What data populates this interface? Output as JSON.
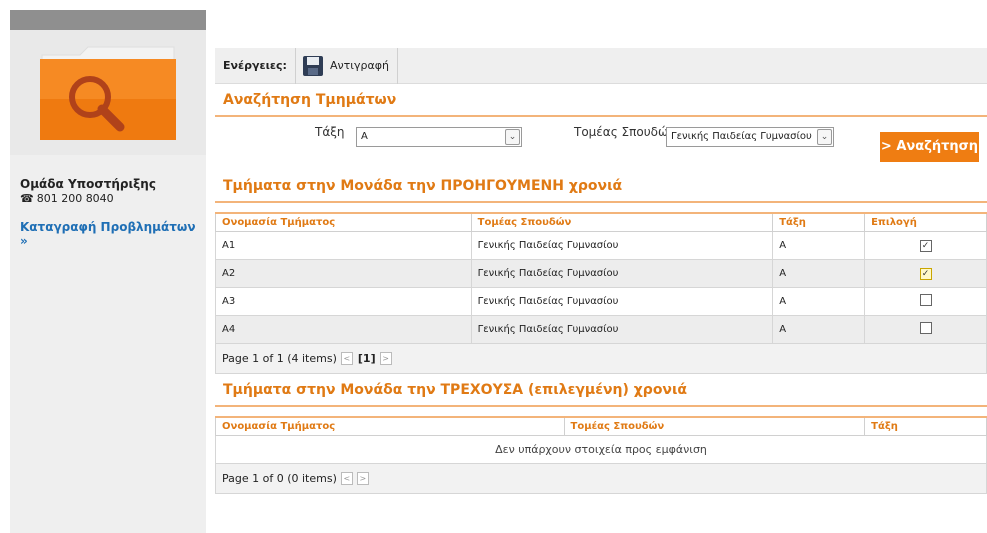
{
  "sidebar": {
    "support_title": "Ομάδα Υποστήριξης",
    "support_phone": "801 200 8040",
    "report_link": "Καταγραφή Προβλημάτων »"
  },
  "toolbar": {
    "actions_label": "Ενέργειες:",
    "copy_label": "Αντιγραφή"
  },
  "search_section": {
    "title": "Αναζήτηση Τμημάτων",
    "class_label": "Τάξη",
    "class_value": "Α",
    "sector_label": "Τομέας Σπουδών",
    "sector_value": "Γενικής Παιδείας Γυμνασίου",
    "search_button": "> Αναζήτηση"
  },
  "previous_year": {
    "title": "Τμήματα στην Μονάδα την ΠΡΟΗΓΟΥΜΕΝΗ χρονιά",
    "columns": [
      "Ονομασία Τμήματος",
      "Τομέας Σπουδών",
      "Τάξη",
      "Επιλογή"
    ],
    "rows": [
      {
        "name": "Α1",
        "sector": "Γενικής Παιδείας Γυμνασίου",
        "class": "Α",
        "checked": "✓"
      },
      {
        "name": "Α2",
        "sector": "Γενικής Παιδείας Γυμνασίου",
        "class": "Α",
        "checked": "✓"
      },
      {
        "name": "Α3",
        "sector": "Γενικής Παιδείας Γυμνασίου",
        "class": "Α",
        "checked": ""
      },
      {
        "name": "Α4",
        "sector": "Γενικής Παιδείας Γυμνασίου",
        "class": "Α",
        "checked": ""
      }
    ],
    "pager_text": "Page 1 of 1 (4 items)",
    "pager_current": "[1]"
  },
  "current_year": {
    "title": "Τμήματα στην Μονάδα την ΤΡΕΧΟΥΣΑ (επιλεγμένη) χρονιά",
    "columns": [
      "Ονομασία Τμήματος",
      "Τομέας Σπουδών",
      "Τάξη"
    ],
    "empty_text": "Δεν υπάρχουν στοιχεία προς εμφάνιση",
    "pager_text": "Page 1 of 0 (0 items)"
  },
  "colors": {
    "accent": "#e07a14",
    "button": "#ef7d12",
    "link": "#1f6fb5"
  }
}
